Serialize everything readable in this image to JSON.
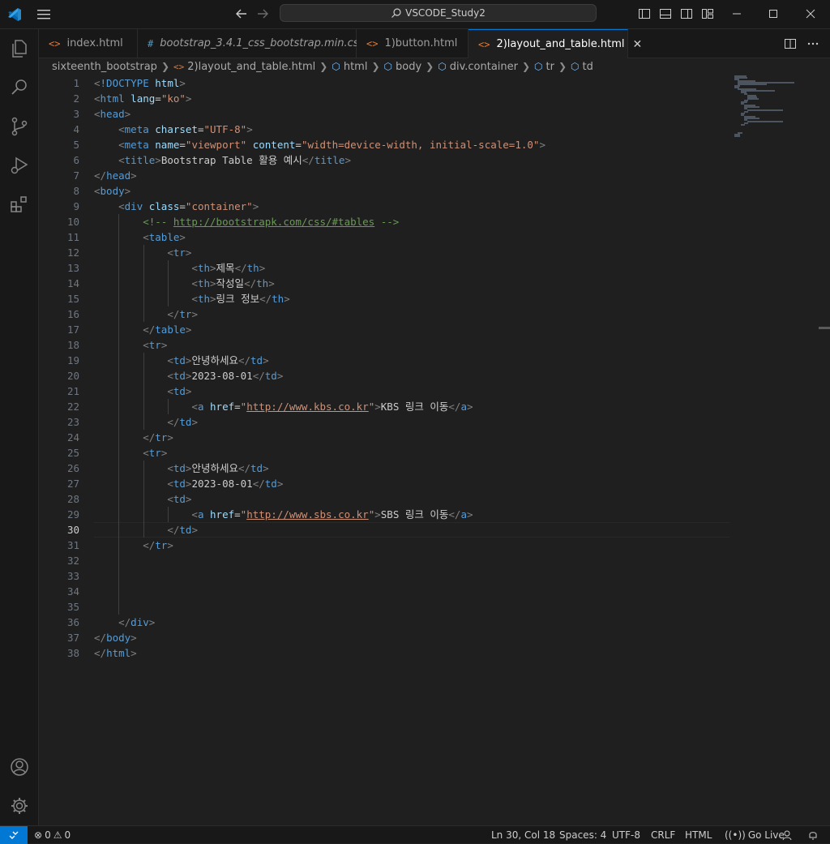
{
  "window": {
    "search_text": "VSCODE_Study2",
    "icons": [
      "vscode-logo",
      "menu-icon",
      "arrow-left-icon",
      "arrow-right-icon",
      "search-icon",
      "toggle-primary-sidebar-icon",
      "toggle-panel-icon",
      "toggle-secondary-sidebar-icon",
      "customize-layout-icon",
      "minimize-icon",
      "maximize-icon",
      "close-icon"
    ]
  },
  "activity_bar": {
    "items": [
      "explorer-icon",
      "search-icon",
      "source-control-icon",
      "run-debug-icon",
      "extensions-icon"
    ],
    "bottom": [
      "accounts-icon",
      "manage-gear-icon"
    ]
  },
  "tabs": [
    {
      "label": "index.html",
      "icon": "<>",
      "type": "html",
      "active": false,
      "italic": false
    },
    {
      "label": "bootstrap_3.4.1_css_bootstrap.min.css",
      "icon": "#",
      "type": "css",
      "active": false,
      "italic": true
    },
    {
      "label": "1)button.html",
      "icon": "<>",
      "type": "html",
      "active": false,
      "italic": false
    },
    {
      "label": "2)layout_and_table.html",
      "icon": "<>",
      "type": "html",
      "active": true,
      "italic": false,
      "close": "✕"
    }
  ],
  "breadcrumb": {
    "folder": "sixteenth_bootstrap",
    "file": "2)layout_and_table.html",
    "symbols": [
      "html",
      "body",
      "div.container",
      "tr",
      "td"
    ]
  },
  "editor": {
    "current_line": 30,
    "lines": [
      [
        [
          "brk",
          "<"
        ],
        [
          "tag",
          "!DOCTYPE"
        ],
        [
          "txt",
          " "
        ],
        [
          "attr",
          "html"
        ],
        [
          "brk",
          ">"
        ]
      ],
      [
        [
          "brk",
          "<"
        ],
        [
          "tag",
          "html"
        ],
        [
          "txt",
          " "
        ],
        [
          "attr",
          "lang"
        ],
        [
          "txt",
          "="
        ],
        [
          "str",
          "\"ko\""
        ],
        [
          "brk",
          ">"
        ]
      ],
      [
        [
          "brk",
          "<"
        ],
        [
          "tag",
          "head"
        ],
        [
          "brk",
          ">"
        ]
      ],
      [
        [
          "txt",
          "    "
        ],
        [
          "brk",
          "<"
        ],
        [
          "tag",
          "meta"
        ],
        [
          "txt",
          " "
        ],
        [
          "attr",
          "charset"
        ],
        [
          "txt",
          "="
        ],
        [
          "str",
          "\"UTF-8\""
        ],
        [
          "brk",
          ">"
        ]
      ],
      [
        [
          "txt",
          "    "
        ],
        [
          "brk",
          "<"
        ],
        [
          "tag",
          "meta"
        ],
        [
          "txt",
          " "
        ],
        [
          "attr",
          "name"
        ],
        [
          "txt",
          "="
        ],
        [
          "str",
          "\"viewport\""
        ],
        [
          "txt",
          " "
        ],
        [
          "attr",
          "content"
        ],
        [
          "txt",
          "="
        ],
        [
          "str",
          "\"width=device-width, initial-scale=1.0\""
        ],
        [
          "brk",
          ">"
        ]
      ],
      [
        [
          "txt",
          "    "
        ],
        [
          "brk",
          "<"
        ],
        [
          "tag",
          "title"
        ],
        [
          "brk",
          ">"
        ],
        [
          "txt",
          "Bootstrap Table 활용 예시"
        ],
        [
          "brk",
          "</"
        ],
        [
          "tag",
          "title"
        ],
        [
          "brk",
          ">"
        ]
      ],
      [
        [
          "brk",
          "</"
        ],
        [
          "tag",
          "head"
        ],
        [
          "brk",
          ">"
        ]
      ],
      [
        [
          "brk",
          "<"
        ],
        [
          "tag",
          "body"
        ],
        [
          "brk",
          ">"
        ]
      ],
      [
        [
          "txt",
          "    "
        ],
        [
          "brk",
          "<"
        ],
        [
          "tag",
          "div"
        ],
        [
          "txt",
          " "
        ],
        [
          "attr",
          "class"
        ],
        [
          "txt",
          "="
        ],
        [
          "str",
          "\"container\""
        ],
        [
          "brk",
          ">"
        ]
      ],
      [
        [
          "txt",
          "        "
        ],
        [
          "cmt",
          "<!-- "
        ],
        [
          "cmtlink",
          "http://bootstrapk.com/css/#tables"
        ],
        [
          "cmt",
          " -->"
        ]
      ],
      [
        [
          "txt",
          "        "
        ],
        [
          "brk",
          "<"
        ],
        [
          "tag",
          "table"
        ],
        [
          "brk",
          ">"
        ]
      ],
      [
        [
          "txt",
          "            "
        ],
        [
          "brk",
          "<"
        ],
        [
          "tag",
          "tr"
        ],
        [
          "brk",
          ">"
        ]
      ],
      [
        [
          "txt",
          "                "
        ],
        [
          "brk",
          "<"
        ],
        [
          "tag",
          "th"
        ],
        [
          "brk",
          ">"
        ],
        [
          "txt",
          "제목"
        ],
        [
          "brk",
          "</"
        ],
        [
          "tag",
          "th"
        ],
        [
          "brk",
          ">"
        ]
      ],
      [
        [
          "txt",
          "                "
        ],
        [
          "brk",
          "<"
        ],
        [
          "tag",
          "th"
        ],
        [
          "brk",
          ">"
        ],
        [
          "txt",
          "작성일"
        ],
        [
          "brk",
          "</"
        ],
        [
          "tag",
          "th"
        ],
        [
          "brk",
          ">"
        ]
      ],
      [
        [
          "txt",
          "                "
        ],
        [
          "brk",
          "<"
        ],
        [
          "tag",
          "th"
        ],
        [
          "brk",
          ">"
        ],
        [
          "txt",
          "링크 정보"
        ],
        [
          "brk",
          "</"
        ],
        [
          "tag",
          "th"
        ],
        [
          "brk",
          ">"
        ]
      ],
      [
        [
          "txt",
          "            "
        ],
        [
          "brk",
          "</"
        ],
        [
          "tag",
          "tr"
        ],
        [
          "brk",
          ">"
        ]
      ],
      [
        [
          "txt",
          "        "
        ],
        [
          "brk",
          "</"
        ],
        [
          "tag",
          "table"
        ],
        [
          "brk",
          ">"
        ]
      ],
      [
        [
          "txt",
          "        "
        ],
        [
          "brk",
          "<"
        ],
        [
          "tag",
          "tr"
        ],
        [
          "brk",
          ">"
        ]
      ],
      [
        [
          "txt",
          "            "
        ],
        [
          "brk",
          "<"
        ],
        [
          "tag",
          "td"
        ],
        [
          "brk",
          ">"
        ],
        [
          "txt",
          "안녕하세요"
        ],
        [
          "brk",
          "</"
        ],
        [
          "tag",
          "td"
        ],
        [
          "brk",
          ">"
        ]
      ],
      [
        [
          "txt",
          "            "
        ],
        [
          "brk",
          "<"
        ],
        [
          "tag",
          "td"
        ],
        [
          "brk",
          ">"
        ],
        [
          "txt",
          "2023-08-01"
        ],
        [
          "brk",
          "</"
        ],
        [
          "tag",
          "td"
        ],
        [
          "brk",
          ">"
        ]
      ],
      [
        [
          "txt",
          "            "
        ],
        [
          "brk",
          "<"
        ],
        [
          "tag",
          "td"
        ],
        [
          "brk",
          ">"
        ]
      ],
      [
        [
          "txt",
          "                "
        ],
        [
          "brk",
          "<"
        ],
        [
          "tag",
          "a"
        ],
        [
          "txt",
          " "
        ],
        [
          "attr",
          "href"
        ],
        [
          "txt",
          "="
        ],
        [
          "str",
          "\""
        ],
        [
          "strlink",
          "http://www.kbs.co.kr"
        ],
        [
          "str",
          "\""
        ],
        [
          "brk",
          ">"
        ],
        [
          "txt",
          "KBS 링크 이동"
        ],
        [
          "brk",
          "</"
        ],
        [
          "tag",
          "a"
        ],
        [
          "brk",
          ">"
        ]
      ],
      [
        [
          "txt",
          "            "
        ],
        [
          "brk",
          "</"
        ],
        [
          "tag",
          "td"
        ],
        [
          "brk",
          ">"
        ]
      ],
      [
        [
          "txt",
          "        "
        ],
        [
          "brk",
          "</"
        ],
        [
          "tag",
          "tr"
        ],
        [
          "brk",
          ">"
        ]
      ],
      [
        [
          "txt",
          "        "
        ],
        [
          "brk",
          "<"
        ],
        [
          "tag",
          "tr"
        ],
        [
          "brk",
          ">"
        ]
      ],
      [
        [
          "txt",
          "            "
        ],
        [
          "brk",
          "<"
        ],
        [
          "tag",
          "td"
        ],
        [
          "brk",
          ">"
        ],
        [
          "txt",
          "안녕하세요"
        ],
        [
          "brk",
          "</"
        ],
        [
          "tag",
          "td"
        ],
        [
          "brk",
          ">"
        ]
      ],
      [
        [
          "txt",
          "            "
        ],
        [
          "brk",
          "<"
        ],
        [
          "tag",
          "td"
        ],
        [
          "brk",
          ">"
        ],
        [
          "txt",
          "2023-08-01"
        ],
        [
          "brk",
          "</"
        ],
        [
          "tag",
          "td"
        ],
        [
          "brk",
          ">"
        ]
      ],
      [
        [
          "txt",
          "            "
        ],
        [
          "brk",
          "<"
        ],
        [
          "tag",
          "td"
        ],
        [
          "brk",
          ">"
        ]
      ],
      [
        [
          "txt",
          "                "
        ],
        [
          "brk",
          "<"
        ],
        [
          "tag",
          "a"
        ],
        [
          "txt",
          " "
        ],
        [
          "attr",
          "href"
        ],
        [
          "txt",
          "="
        ],
        [
          "str",
          "\""
        ],
        [
          "strlink",
          "http://www.sbs.co.kr"
        ],
        [
          "str",
          "\""
        ],
        [
          "brk",
          ">"
        ],
        [
          "txt",
          "SBS 링크 이동"
        ],
        [
          "brk",
          "</"
        ],
        [
          "tag",
          "a"
        ],
        [
          "brk",
          ">"
        ]
      ],
      [
        [
          "txt",
          "            "
        ],
        [
          "brk",
          "</"
        ],
        [
          "tag",
          "td"
        ],
        [
          "brk",
          ">"
        ]
      ],
      [
        [
          "txt",
          "        "
        ],
        [
          "brk",
          "</"
        ],
        [
          "tag",
          "tr"
        ],
        [
          "brk",
          ">"
        ]
      ],
      [],
      [],
      [],
      [],
      [
        [
          "txt",
          "    "
        ],
        [
          "brk",
          "</"
        ],
        [
          "tag",
          "div"
        ],
        [
          "brk",
          ">"
        ]
      ],
      [
        [
          "brk",
          "</"
        ],
        [
          "tag",
          "body"
        ],
        [
          "brk",
          ">"
        ]
      ],
      [
        [
          "brk",
          "</"
        ],
        [
          "tag",
          "html"
        ],
        [
          "brk",
          ">"
        ]
      ]
    ]
  },
  "status_bar": {
    "errors": "0",
    "warnings": "0",
    "position": "Ln 30, Col 18",
    "spaces": "Spaces: 4",
    "encoding": "UTF-8",
    "eol": "CRLF",
    "language": "HTML",
    "go_live": "Go Live",
    "colors": {
      "remote_bg": "#0078d4",
      "tab_accent": "#0078d4"
    }
  }
}
